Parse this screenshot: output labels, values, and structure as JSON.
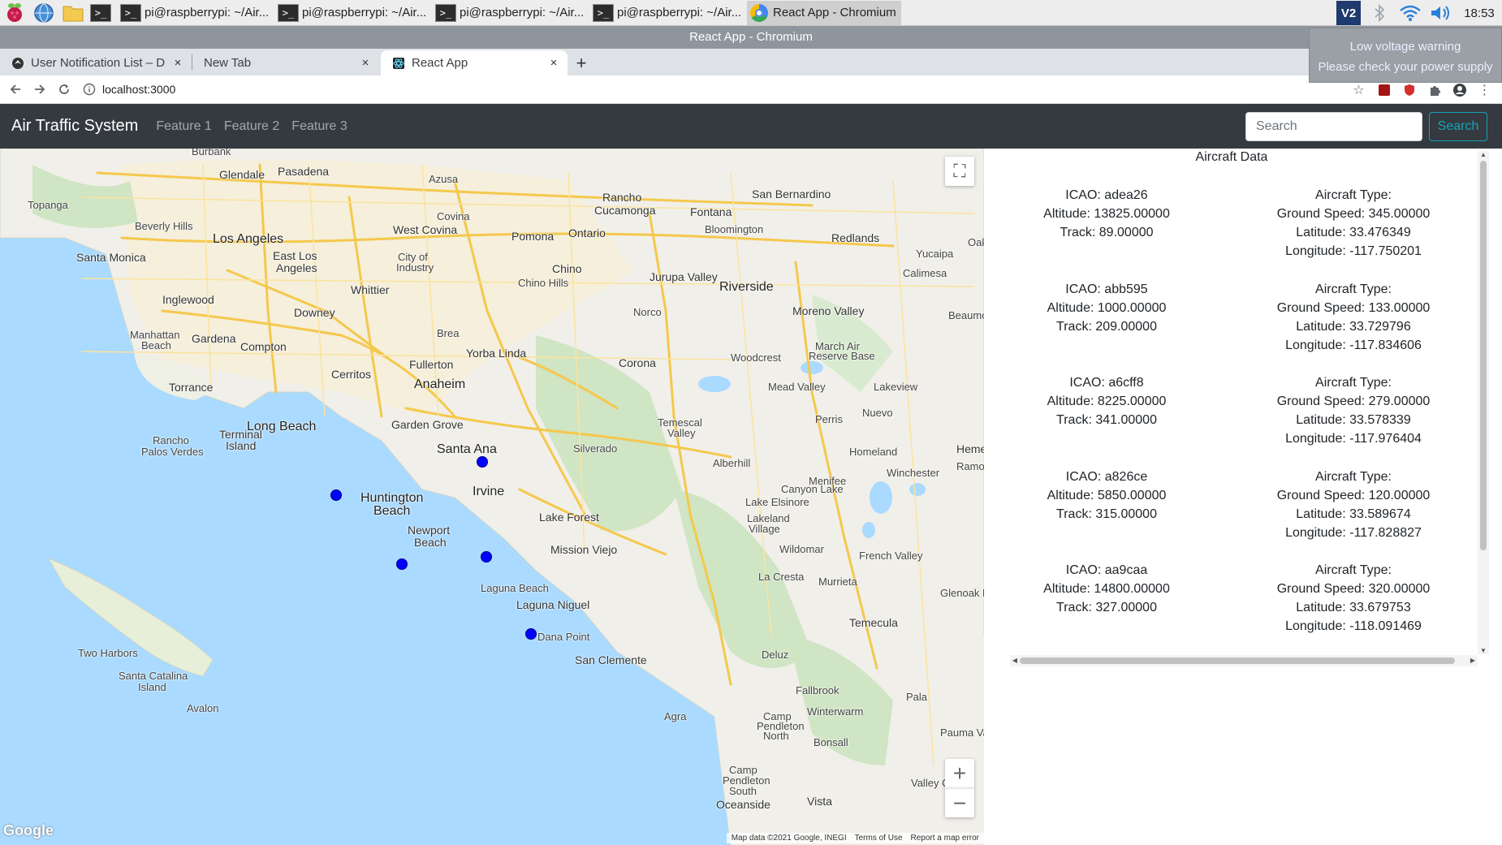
{
  "taskbar": {
    "tasks": [
      {
        "label": "pi@raspberrypi: ~/Air..."
      },
      {
        "label": "pi@raspberrypi: ~/Air..."
      },
      {
        "label": "pi@raspberrypi: ~/Air..."
      },
      {
        "label": "pi@raspberrypi: ~/Air..."
      },
      {
        "label": "React App - Chromium"
      }
    ],
    "tray": {
      "vnc_label": "V2",
      "clock": "18:53"
    }
  },
  "window": {
    "title": "React App - Chromium"
  },
  "tooltip": {
    "line1": "Low voltage warning",
    "line2": "Please check your power supply"
  },
  "browser": {
    "tabs": [
      {
        "title": "User Notification List – D",
        "close": "×"
      },
      {
        "title": "New Tab",
        "close": "×"
      },
      {
        "title": "React App",
        "close": "×"
      }
    ],
    "new_tab": "+",
    "url": "localhost:3000"
  },
  "app": {
    "brand": "Air Traffic System",
    "nav": [
      "Feature 1",
      "Feature 2",
      "Feature 3"
    ],
    "search": {
      "placeholder": "Search",
      "button": "Search"
    }
  },
  "map": {
    "labels": {
      "burbank": "Burbank",
      "glendale": "Glendale",
      "pasadena": "Pasadena",
      "azusa": "Azusa",
      "rancho": "Rancho",
      "cucamonga": "Cucamonga",
      "fontana": "Fontana",
      "san_bernardino": "San Bernardino",
      "topanga": "Topanga",
      "beverly_hills": "Beverly Hills",
      "los_angeles": "Los Angeles",
      "west_covina": "West Covina",
      "covina": "Covina",
      "pomona": "Pomona",
      "ontario": "Ontario",
      "bloomington": "Bloomington",
      "redlands": "Redlands",
      "santa_monica": "Santa Monica",
      "east_los": "East Los",
      "angeles": "Angeles",
      "city_of": "City of",
      "industry": "Industry",
      "chino": "Chino",
      "jurupa_valley": "Jurupa Valley",
      "yucaipa": "Yucaipa",
      "calimesa": "Calimesa",
      "whittier": "Whittier",
      "chino_hills": "Chino Hills",
      "riverside": "Riverside",
      "inglewood": "Inglewood",
      "downey": "Downey",
      "norco": "Norco",
      "moreno_valley": "Moreno Valley",
      "beaumo": "Beaumo",
      "manhattan": "Manhattan",
      "beach": "Beach",
      "gardena": "Gardena",
      "compton": "Compton",
      "brea": "Brea",
      "yorba_linda": "Yorba Linda",
      "march_air": "March Air",
      "reserve_base": "Reserve Base",
      "woodcrest": "Woodcrest",
      "cerritos": "Cerritos",
      "fullerton": "Fullerton",
      "corona": "Corona",
      "torrance": "Torrance",
      "anaheim": "Anaheim",
      "mead_valley": "Mead Valley",
      "lakeview": "Lakeview",
      "nuevo": "Nuevo",
      "long_beach": "Long Beach",
      "garden_grove": "Garden Grove",
      "perris": "Perris",
      "temescal": "Temescal",
      "valley": "Valley",
      "rancho2": "Rancho",
      "palos_verdes": "Palos Verdes",
      "terminal": "Terminal",
      "island": "Island",
      "santa_ana": "Santa Ana",
      "silverado": "Silverado",
      "homeland": "Homeland",
      "heme": "Heme",
      "alberhill": "Alberhill",
      "ramo": "Ramo",
      "winchester": "Winchester",
      "menifee": "Menifee",
      "irvine": "Irvine",
      "huntington": "Huntington",
      "beach2": "Beach",
      "canyon_lake": "Canyon Lake",
      "lake_elsinore": "Lake Elsinore",
      "lake_forest": "Lake Forest",
      "newport": "Newport",
      "beach3": "Beach",
      "lakeland": "Lakeland",
      "village": "Village",
      "mission_viejo": "Mission Viejo",
      "wildomar": "Wildomar",
      "french_valley": "French Valley",
      "la_cresta": "La Cresta",
      "murrieta": "Murrieta",
      "laguna_beach": "Laguna Beach",
      "glenoak": "Glenoak H",
      "laguna_niguel": "Laguna Niguel",
      "temecula": "Temecula",
      "two_harbors": "Two Harbors",
      "dana_point": "Dana Point",
      "deluz": "Deluz",
      "san_clemente": "San Clemente",
      "santa_catalina": "Santa Catalina",
      "island2": "Island",
      "fallbrook": "Fallbrook",
      "pala": "Pala",
      "avalon": "Avalon",
      "agra": "Agra",
      "winterwarm": "Winterwarm",
      "camp": "Camp",
      "pendleton": "Pendleton",
      "north": "North",
      "bonsall": "Bonsall",
      "pauma_va": "Pauma Va",
      "camp2": "Camp",
      "pendleton2": "Pendleton",
      "south": "South",
      "valley_c": "Valley C",
      "oceanside": "Oceanside",
      "vista": "Vista",
      "oak": "Oak"
    },
    "controls": {
      "fullscreen": "⛶",
      "zoom_in": "+",
      "zoom_out": "−"
    },
    "logo": "Google",
    "attribution": {
      "data": "Map data ©2021 Google, INEGI",
      "terms": "Terms of Use",
      "report": "Report a map error"
    }
  },
  "panel": {
    "title": "Aircraft Data",
    "aircraft": [
      {
        "icao": "ICAO: adea26",
        "altitude": "Altitude: 13825.00000",
        "track": "Track: 89.00000",
        "type": "Aircraft Type:",
        "speed": "Ground Speed: 345.00000",
        "lat": "Latitude: 33.476349",
        "lon": "Longitude: -117.750201"
      },
      {
        "icao": "ICAO: abb595",
        "altitude": "Altitude: 1000.00000",
        "track": "Track: 209.00000",
        "type": "Aircraft Type:",
        "speed": "Ground Speed: 133.00000",
        "lat": "Latitude: 33.729796",
        "lon": "Longitude: -117.834606"
      },
      {
        "icao": "ICAO: a6cff8",
        "altitude": "Altitude: 8225.00000",
        "track": "Track: 341.00000",
        "type": "Aircraft Type:",
        "speed": "Ground Speed: 279.00000",
        "lat": "Latitude: 33.578339",
        "lon": "Longitude: -117.976404"
      },
      {
        "icao": "ICAO: a826ce",
        "altitude": "Altitude: 5850.00000",
        "track": "Track: 315.00000",
        "type": "Aircraft Type:",
        "speed": "Ground Speed: 120.00000",
        "lat": "Latitude: 33.589674",
        "lon": "Longitude: -117.828827"
      },
      {
        "icao": "ICAO: aa9caa",
        "altitude": "Altitude: 14800.00000",
        "track": "Track: 327.00000",
        "type": "Aircraft Type:",
        "speed": "Ground Speed: 320.00000",
        "lat": "Latitude: 33.679753",
        "lon": "Longitude: -118.091469"
      }
    ]
  },
  "colors": {
    "navbar": "#343a40",
    "marker": "#0000ff",
    "search_outline": "#17a2b8",
    "water": "#aadaff",
    "land": "#f1efe9"
  },
  "icons": [
    "raspberry-menu-icon",
    "web-browser-icon",
    "file-manager-icon",
    "terminal-icon",
    "chromium-icon",
    "vnc-icon",
    "bluetooth-icon",
    "wifi-icon",
    "volume-icon",
    "back-icon",
    "forward-icon",
    "reload-icon",
    "info-icon",
    "bookmark-star-icon",
    "extension-icon",
    "profile-icon",
    "menu-dots-icon"
  ]
}
